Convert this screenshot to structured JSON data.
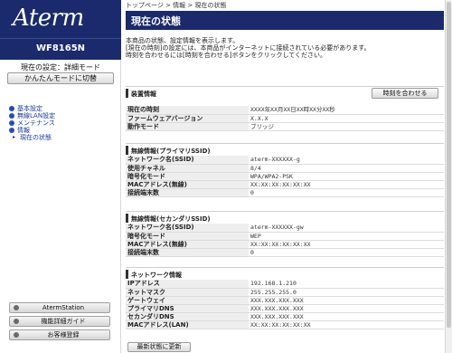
{
  "sidebar": {
    "logo": "Aterm",
    "model": "WF8165N",
    "mode_text": "現在の設定：詳細モード",
    "simple_mode_button": "かんたんモードに切替",
    "nav": [
      {
        "label": "基本設定"
      },
      {
        "label": "無線LAN設定"
      },
      {
        "label": "メンテナンス"
      },
      {
        "label": "情報"
      }
    ],
    "nav_sub": {
      "label": "現在の状態"
    },
    "buttons": [
      {
        "label": "AtermStation"
      },
      {
        "label": "機能詳細ガイド"
      },
      {
        "label": "お客様登録"
      }
    ]
  },
  "breadcrumb": "トップページ > 情報 > 現在の状態",
  "page_title": "現在の状態",
  "intro": [
    "本商品の状態、設定情報を表示します。",
    "[現在の時刻]の設定には、本商品がインターネットに接続されている必要があります。",
    "時刻を合わせるには[時刻を合わせる]ボタンをクリックしてください。"
  ],
  "device": {
    "title": "装置情報",
    "sync_button": "時刻を合わせる",
    "rows": [
      {
        "key": "現在の時刻",
        "value": "XXXX年XX月XX日XX時XX分XX秒"
      },
      {
        "key": "ファームウェアバージョン",
        "value": "X.X.X"
      },
      {
        "key": "動作モード",
        "value": "ブリッジ"
      }
    ]
  },
  "wireless_primary": {
    "title": "無線情報(プライマリSSID)",
    "rows": [
      {
        "key": "ネットワーク名(SSID)",
        "value": "aterm-XXXXXX-g"
      },
      {
        "key": "使用チャネル",
        "value": "8/4"
      },
      {
        "key": "暗号化モード",
        "value": "WPA/WPA2-PSK"
      },
      {
        "key": "MACアドレス(無線)",
        "value": "XX:XX:XX:XX:XX:XX"
      },
      {
        "key": "接続端末数",
        "value": "0"
      }
    ]
  },
  "wireless_secondary": {
    "title": "無線情報(セカンダリSSID)",
    "rows": [
      {
        "key": "ネットワーク名(SSID)",
        "value": "aterm-XXXXXX-gw"
      },
      {
        "key": "暗号化モード",
        "value": "WEP"
      },
      {
        "key": "MACアドレス(無線)",
        "value": "XX:XX:XX:XX:XX:XX"
      },
      {
        "key": "接続端末数",
        "value": "0"
      }
    ]
  },
  "network": {
    "title": "ネットワーク情報",
    "rows": [
      {
        "key": "IPアドレス",
        "value": "192.168.1.210"
      },
      {
        "key": "ネットマスク",
        "value": "255.255.255.0"
      },
      {
        "key": "ゲートウェイ",
        "value": "XXX.XXX.XXX.XXX"
      },
      {
        "key": "プライマリDNS",
        "value": "XXX.XXX.XXX.XXX"
      },
      {
        "key": "セカンダリDNS",
        "value": "XXX.XXX.XXX.XXX"
      },
      {
        "key": "MACアドレス(LAN)",
        "value": "XX:XX:XX:XX:XX:XX"
      }
    ]
  },
  "refresh_button": "最新状態に更新",
  "colors": {
    "header_navy": "#1a2a6c",
    "nav_link": "#1a3aa0",
    "label_bg": "#eeeeee"
  }
}
